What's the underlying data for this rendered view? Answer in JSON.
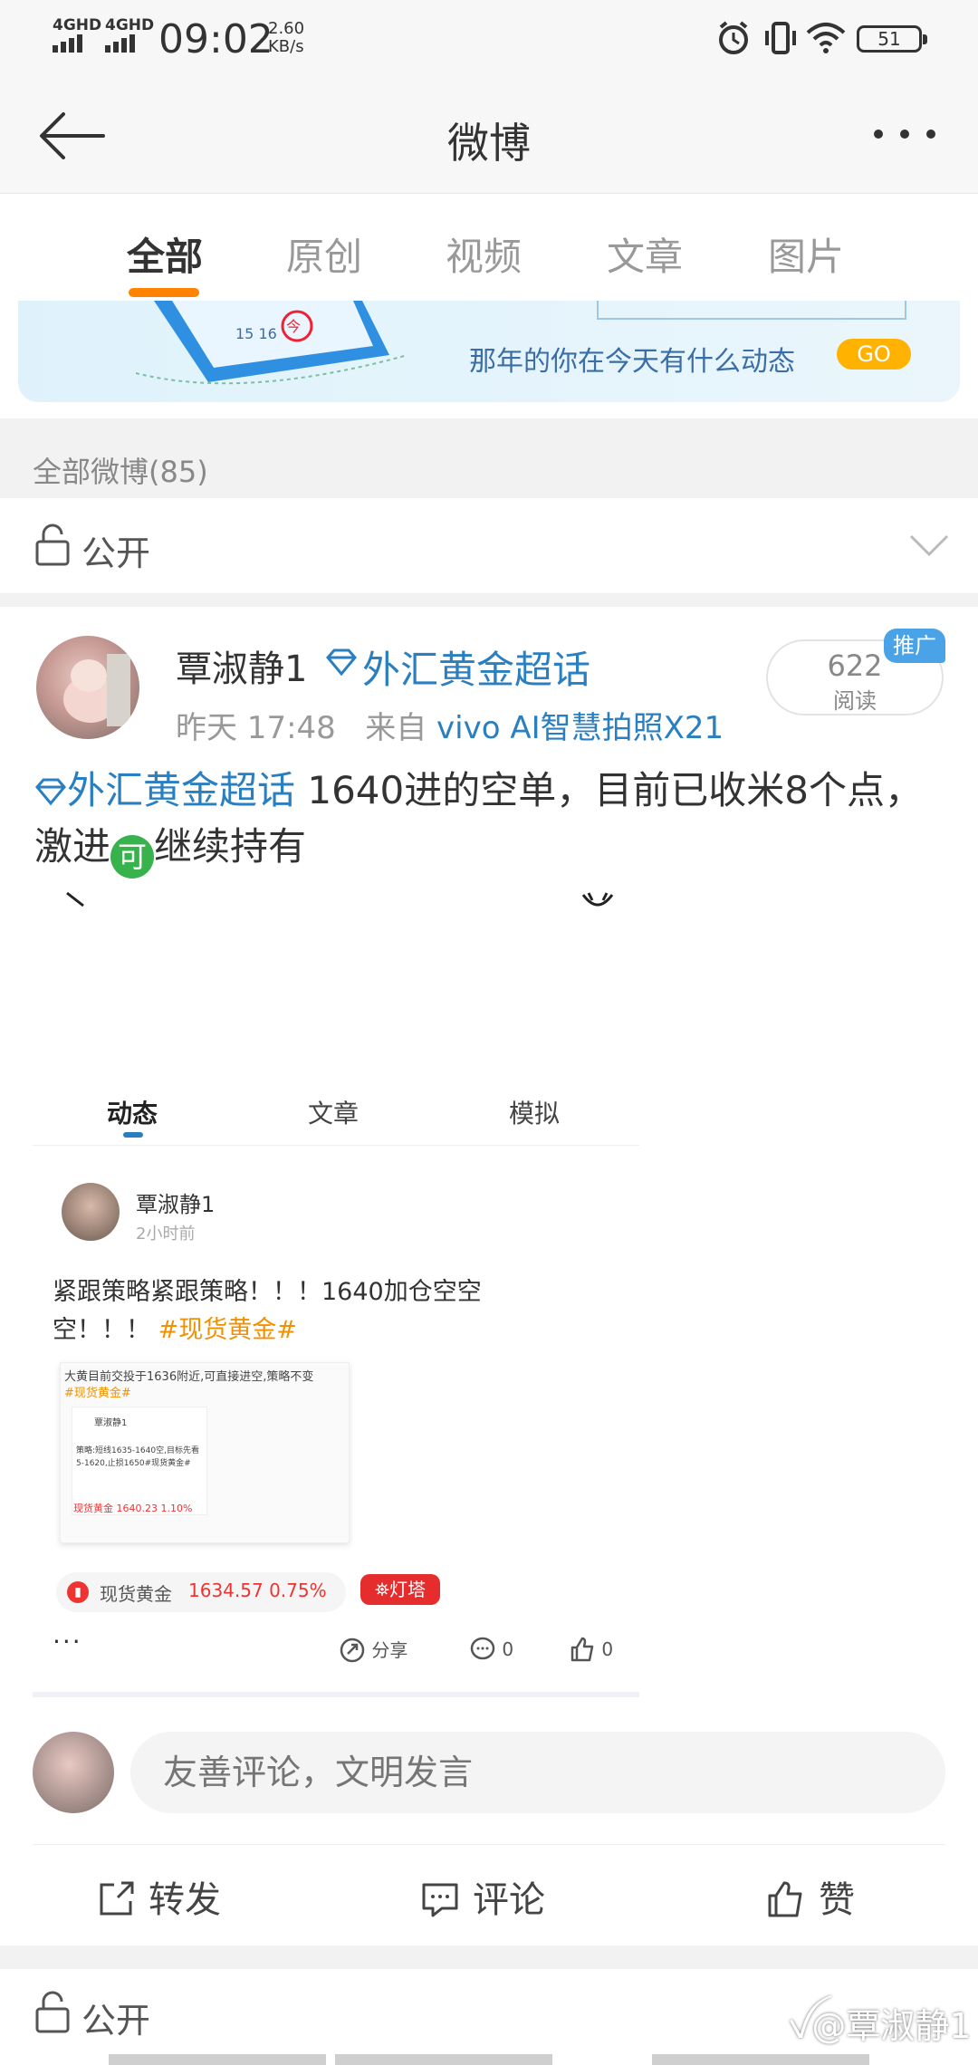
{
  "status_bar": {
    "signal1": "4GHD",
    "signal2": "4GHD",
    "time": "09:02",
    "speed_value": "2.60",
    "speed_unit": "KB/s",
    "battery": "51"
  },
  "nav": {
    "title": "微博"
  },
  "tabs": [
    "全部",
    "原创",
    "视频",
    "文章",
    "图片"
  ],
  "banner": {
    "text": "那年的你在今天有什么动态",
    "go": "GO"
  },
  "section": {
    "title": "全部微博(85)",
    "visibility": "公开"
  },
  "post": {
    "username": "覃淑静1",
    "topic": "外汇黄金超话",
    "time": "昨天 17:48",
    "source_prefix": "来自",
    "source": "vivo AI智慧拍照X21",
    "read_count": "622",
    "read_label": "阅读",
    "promo": "推广",
    "body_topic": "外汇黄金超话",
    "body_text1": " 1640进的空单，目前已收米8个点，激进",
    "emoji": "可",
    "body_text2": "继续持有"
  },
  "embed": {
    "tabs": [
      "动态",
      "文章",
      "模拟"
    ],
    "name": "覃淑静1",
    "time": "2小时前",
    "text": "紧跟策略紧跟策略！！！1640加仓空空空！！！ ",
    "tag": "#现货黄金#",
    "thumb_line1": "大黄目前交投于1636附近,可直接进空,策略不变",
    "thumb_tag": "#现货黄金#",
    "thumb_name": "覃淑静1",
    "thumb_line2": "策略:短线1635-1640空,目标先看",
    "thumb_line3": "5-1620,止损1650#现货黄金#",
    "thumb_chip": "现货黄金  1640.23 1.10%",
    "chip_name": "现货黄金",
    "chip_price": "1634.57 0.75%",
    "lamp": "灯塔",
    "more": "···",
    "share": "分享",
    "comment_count": "0",
    "like_count": "0"
  },
  "comment": {
    "placeholder": "友善评论，文明发言"
  },
  "actions": {
    "repost": "转发",
    "comment": "评论",
    "like": "赞"
  },
  "footer": {
    "visibility": "公开",
    "watermark": "@覃淑静1"
  },
  "colors": {
    "accent": "#ff8200",
    "link": "#2a7fc0",
    "red": "#e33333"
  }
}
